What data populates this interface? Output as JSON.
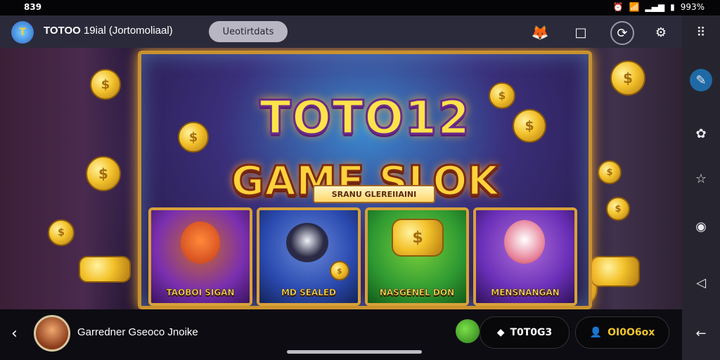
{
  "status": {
    "time": "839",
    "battery": "993%"
  },
  "topbar": {
    "logo_text": "T",
    "title_bold": "TOTOO",
    "title_rest": " 19ial (Jortomoliaal)",
    "url_pill": "Ueotirtdats"
  },
  "banner": {
    "title_line1": "TOTO12",
    "title_line2": "GAME SLOK",
    "subtitle": "SRANU GLEREIIAINI",
    "coin_symbol": "$",
    "cards": [
      {
        "label": "TAOBOI SIGAN",
        "color": "#7a2fb0"
      },
      {
        "label": "MD SEALED",
        "color": "#2a4ab0"
      },
      {
        "label": "NASGENEL DON",
        "color": "#2f9a32"
      },
      {
        "label": "MENSNANGAN",
        "color": "#6a2fb8"
      }
    ]
  },
  "bottombar": {
    "player_name": "Garredner Gseoco Jnoike",
    "balance_1": "T0T0G3",
    "balance_2": "OI0O6ox"
  },
  "colors": {
    "accent": "#f0c430",
    "frame": "#c9922e",
    "active_side": "#1f6aa6"
  }
}
